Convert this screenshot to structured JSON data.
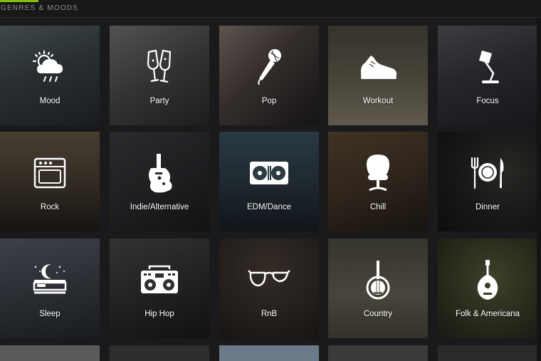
{
  "header": {
    "title": "GENRES & MOODS",
    "accent_color": "#84bd00"
  },
  "tiles": [
    {
      "label": "Mood",
      "icon": "weather-cloud-icon"
    },
    {
      "label": "Party",
      "icon": "champagne-glasses-icon"
    },
    {
      "label": "Pop",
      "icon": "microphone-icon"
    },
    {
      "label": "Workout",
      "icon": "sneaker-icon"
    },
    {
      "label": "Focus",
      "icon": "desk-lamp-icon"
    },
    {
      "label": "Rock",
      "icon": "amplifier-icon"
    },
    {
      "label": "Indie/Alternative",
      "icon": "electric-guitar-icon"
    },
    {
      "label": "EDM/Dance",
      "icon": "turntables-icon"
    },
    {
      "label": "Chill",
      "icon": "egg-chair-icon"
    },
    {
      "label": "Dinner",
      "icon": "plate-cutlery-icon"
    },
    {
      "label": "Sleep",
      "icon": "bed-moon-icon"
    },
    {
      "label": "Hip Hop",
      "icon": "boombox-icon"
    },
    {
      "label": "RnB",
      "icon": "aviator-glasses-icon"
    },
    {
      "label": "Country",
      "icon": "banjo-icon"
    },
    {
      "label": "Folk & Americana",
      "icon": "mandolin-icon"
    }
  ]
}
